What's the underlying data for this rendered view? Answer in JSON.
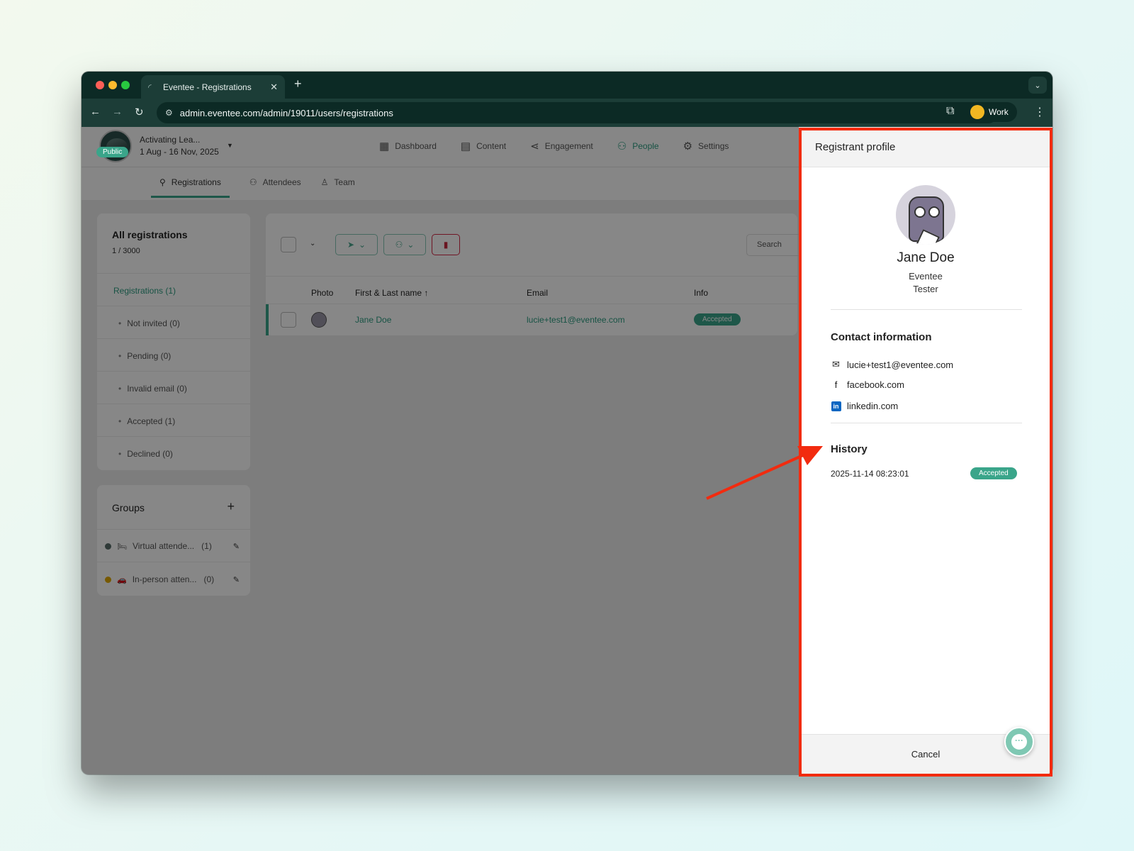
{
  "browser": {
    "tab_title": "Eventee - Registrations",
    "url": "admin.eventee.com/admin/19011/users/registrations",
    "profile_label": "Work"
  },
  "event": {
    "visibility_badge": "Public",
    "name": "Activating Lea...",
    "dates": "1 Aug - 16 Nov, 2025"
  },
  "main_nav": [
    {
      "label": "Dashboard",
      "icon": "dashboard-icon"
    },
    {
      "label": "Content",
      "icon": "calendar-icon"
    },
    {
      "label": "Engagement",
      "icon": "share-icon"
    },
    {
      "label": "People",
      "icon": "people-icon",
      "active": true
    },
    {
      "label": "Settings",
      "icon": "gear-icon"
    }
  ],
  "subnav": [
    {
      "label": "Registrations",
      "active": true
    },
    {
      "label": "Attendees"
    },
    {
      "label": "Team"
    }
  ],
  "registrations_card": {
    "title": "All registrations",
    "count": "1 / 3000",
    "active_item": "Registrations (1)",
    "items": [
      "Not invited (0)",
      "Pending (0)",
      "Invalid email (0)",
      "Accepted (1)",
      "Declined (0)"
    ]
  },
  "groups_card": {
    "title": "Groups",
    "groups": [
      {
        "label": "Virtual attende...",
        "count": "(1)",
        "color": "#5a6e6a",
        "emoji": "🛏"
      },
      {
        "label": "In-person atten...",
        "count": "(0)",
        "color": "#e0a800",
        "emoji": "🚗"
      }
    ]
  },
  "table": {
    "search_placeholder": "Search",
    "columns": [
      "Photo",
      "First & Last name ↑",
      "Email",
      "Info"
    ],
    "rows": [
      {
        "name": "Jane Doe",
        "email": "lucie+test1@eventee.com",
        "status": "Accepted"
      }
    ]
  },
  "profile_panel": {
    "title": "Registrant profile",
    "name": "Jane Doe",
    "company": "Eventee",
    "position": "Tester",
    "contact_title": "Contact information",
    "email": "lucie+test1@eventee.com",
    "facebook": "facebook.com",
    "linkedin": "linkedin.com",
    "history_title": "History",
    "history": [
      {
        "date": "2025-11-14 08:23:01",
        "status": "Accepted"
      }
    ],
    "cancel_label": "Cancel"
  },
  "colors": {
    "brand": "#3aa58a",
    "annotation": "#f22b0f"
  }
}
